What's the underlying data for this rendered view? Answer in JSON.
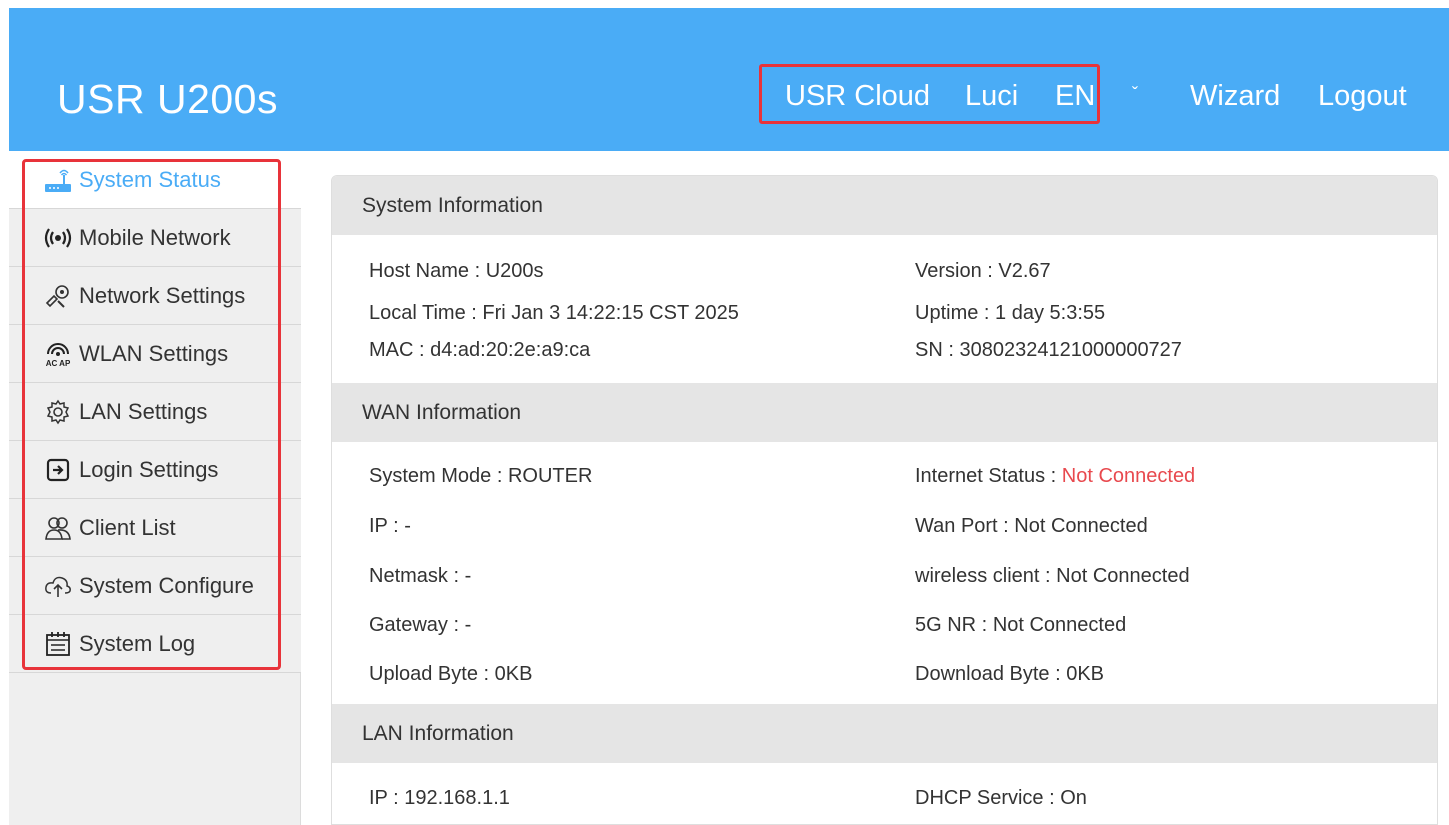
{
  "header": {
    "brand": "USR U200s",
    "nav": {
      "usr_cloud": "USR Cloud",
      "luci": "Luci",
      "language": "EN",
      "wizard": "Wizard",
      "logout": "Logout"
    }
  },
  "sidebar": {
    "items": [
      {
        "label": "System Status",
        "icon": "router-icon"
      },
      {
        "label": "Mobile Network",
        "icon": "wireless-signal-icon"
      },
      {
        "label": "Network Settings",
        "icon": "network-settings-icon"
      },
      {
        "label": "WLAN Settings",
        "icon": "wlan-acap-icon"
      },
      {
        "label": "LAN Settings",
        "icon": "gear-icon"
      },
      {
        "label": "Login Settings",
        "icon": "login-icon"
      },
      {
        "label": "Client List",
        "icon": "users-icon"
      },
      {
        "label": "System Configure",
        "icon": "cloud-upload-icon"
      },
      {
        "label": "System Log",
        "icon": "calendar-log-icon"
      }
    ]
  },
  "system_info": {
    "title": "System Information",
    "host_name_label": "Host Name :",
    "host_name": "U200s",
    "version_label": "Version :",
    "version": "V2.67",
    "local_time_label": "Local Time :",
    "local_time": "Fri Jan 3 14:22:15 CST 2025",
    "uptime_label": "Uptime :",
    "uptime": "1 day 5:3:55",
    "mac_label": "MAC :",
    "mac": "d4:ad:20:2e:a9:ca",
    "sn_label": "SN :",
    "sn": "30802324121000000727"
  },
  "wan_info": {
    "title": "WAN Information",
    "system_mode_label": "System Mode :",
    "system_mode": "ROUTER",
    "internet_status_label": "Internet Status :",
    "internet_status": "Not Connected",
    "ip_label": "IP :",
    "ip": "-",
    "wan_port_label": "Wan Port :",
    "wan_port": "Not Connected",
    "netmask_label": "Netmask :",
    "netmask": "-",
    "wireless_client_label": "wireless client :",
    "wireless_client": "Not Connected",
    "gateway_label": "Gateway :",
    "gateway": "-",
    "nr5g_label": "5G NR :",
    "nr5g": "Not Connected",
    "upload_label": "Upload Byte :",
    "upload": "0KB",
    "download_label": "Download Byte :",
    "download": "0KB"
  },
  "lan_info": {
    "title": "LAN Information",
    "ip_label": "IP :",
    "ip": "192.168.1.1",
    "dhcp_label": "DHCP Service :",
    "dhcp": "On"
  },
  "colors": {
    "header_bg": "#4aacf6",
    "highlight_border": "#e8333a",
    "status_error": "#e8494e",
    "active_item": "#4aacf6"
  }
}
